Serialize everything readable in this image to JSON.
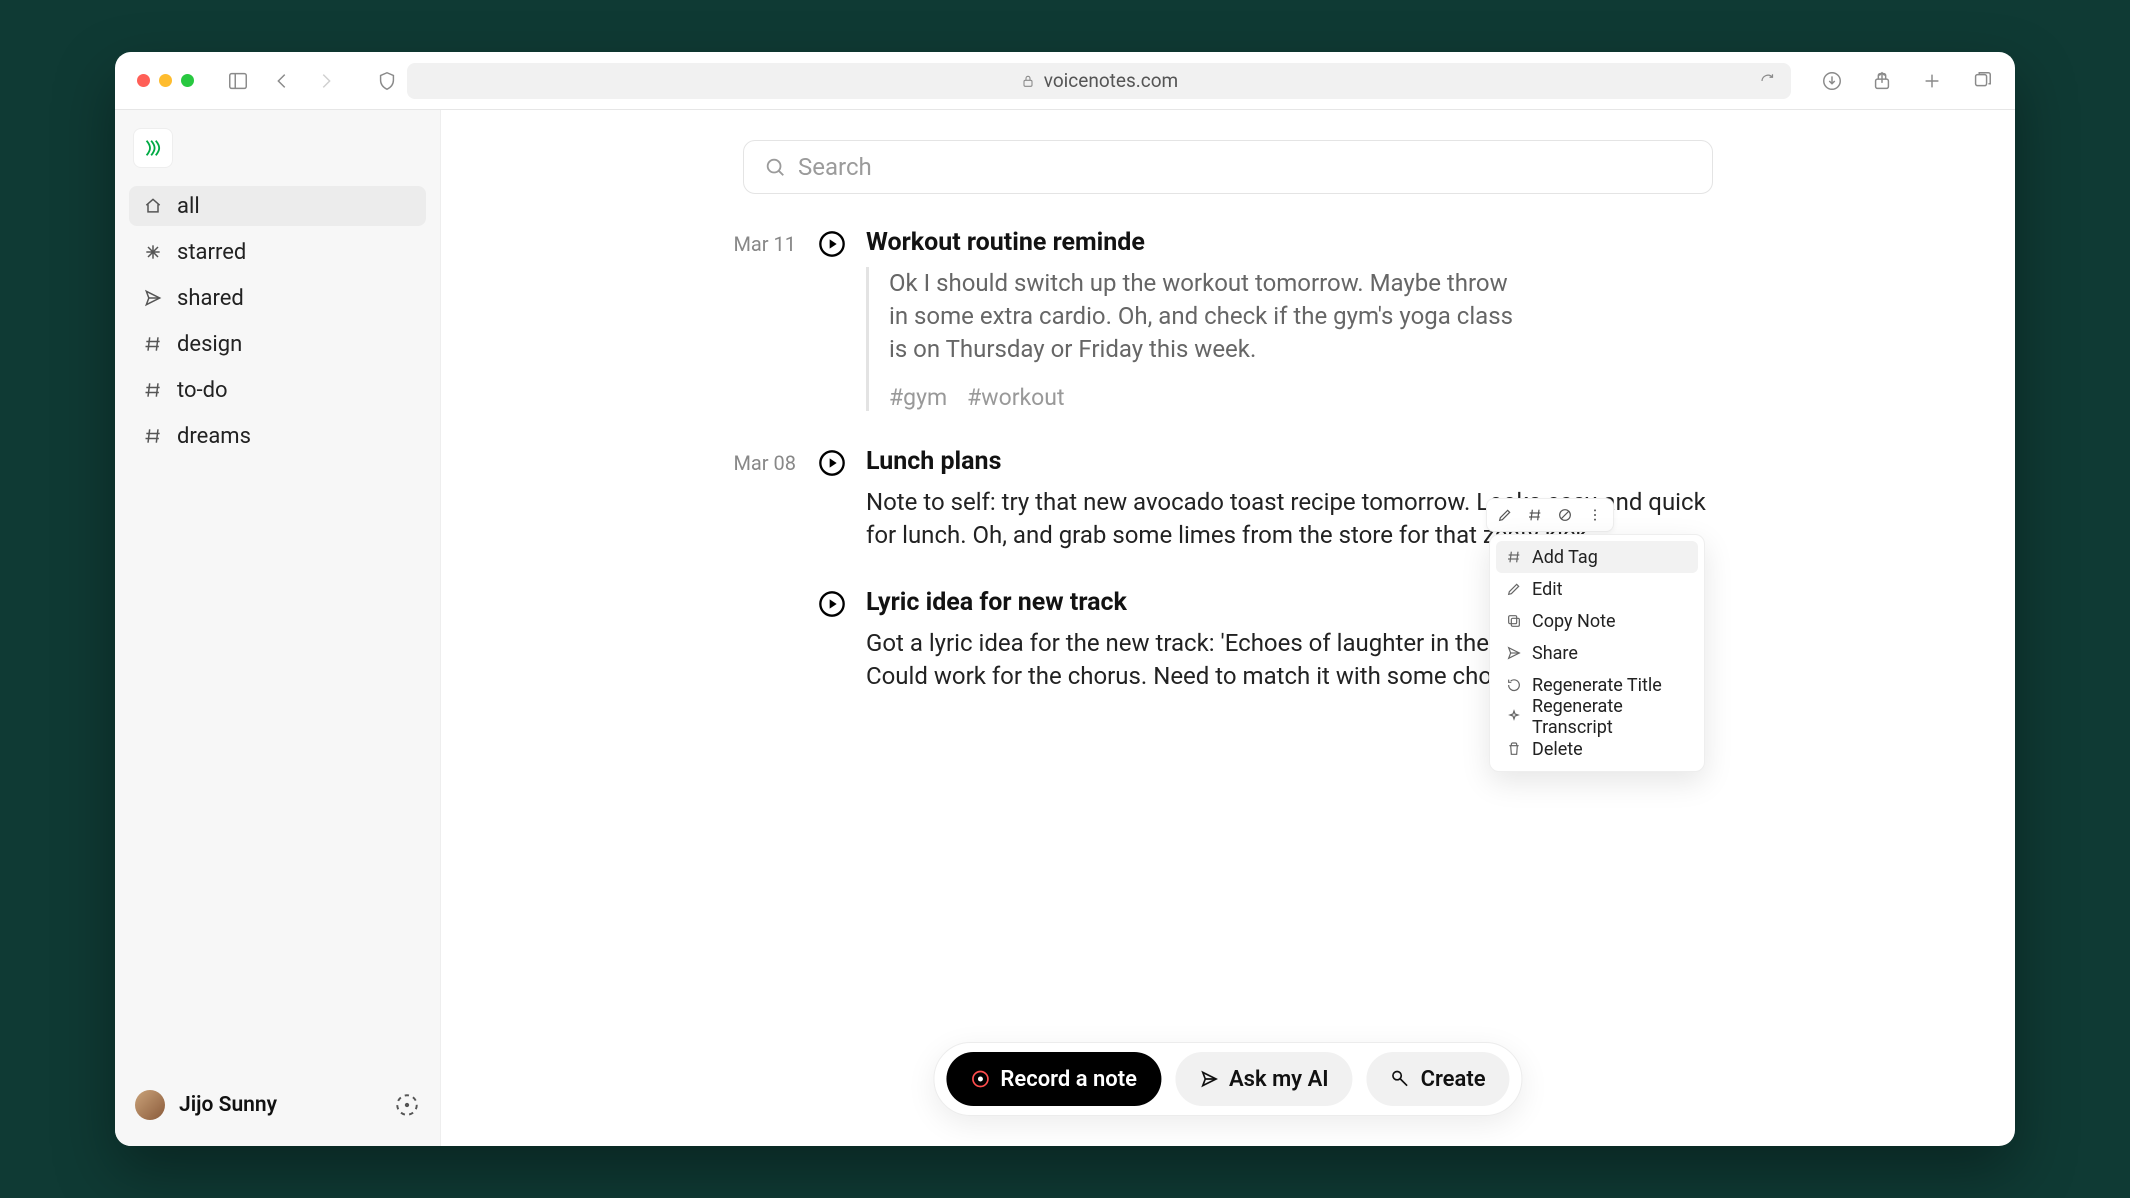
{
  "browser": {
    "url_host": "voicenotes.com"
  },
  "sidebar": {
    "items": [
      {
        "label": "all",
        "icon": "home"
      },
      {
        "label": "starred",
        "icon": "spark"
      },
      {
        "label": "shared",
        "icon": "send"
      },
      {
        "label": "design",
        "icon": "hash"
      },
      {
        "label": "to-do",
        "icon": "hash"
      },
      {
        "label": "dreams",
        "icon": "hash"
      }
    ],
    "user": "Jijo Sunny"
  },
  "search": {
    "placeholder": "Search"
  },
  "notes": [
    {
      "date": "Mar 11",
      "title": "Workout routine reminde",
      "text": "Ok I should switch up the workout tomorrow. Maybe throw in some extra cardio. Oh, and check if the gym's yoga class is on Thursday or Friday this week.",
      "tags": [
        "#gym",
        "#workout"
      ]
    },
    {
      "date": "Mar 08",
      "title": "Lunch plans",
      "text": "Note to self: try that new avocado toast recipe tomorrow. Looks easy and quick for lunch. Oh, and grab some limes from the store for that zesty kick."
    },
    {
      "date": "",
      "title": "Lyric idea for new track",
      "text": "Got a lyric idea for the new track: 'Echoes of laughter in the quiet night'. Could work for the chorus. Need to match it with some chords later."
    }
  ],
  "fab": {
    "record": "Record a note",
    "ask": "Ask my AI",
    "create": "Create"
  },
  "context_menu": {
    "items": [
      {
        "label": "Add Tag",
        "icon": "hash"
      },
      {
        "label": "Edit",
        "icon": "pencil"
      },
      {
        "label": "Copy Note",
        "icon": "copy"
      },
      {
        "label": "Share",
        "icon": "send"
      },
      {
        "label": "Regenerate Title",
        "icon": "refresh"
      },
      {
        "label": "Regenerate Transcript",
        "icon": "sparkle"
      },
      {
        "label": "Delete",
        "icon": "trash"
      }
    ]
  }
}
